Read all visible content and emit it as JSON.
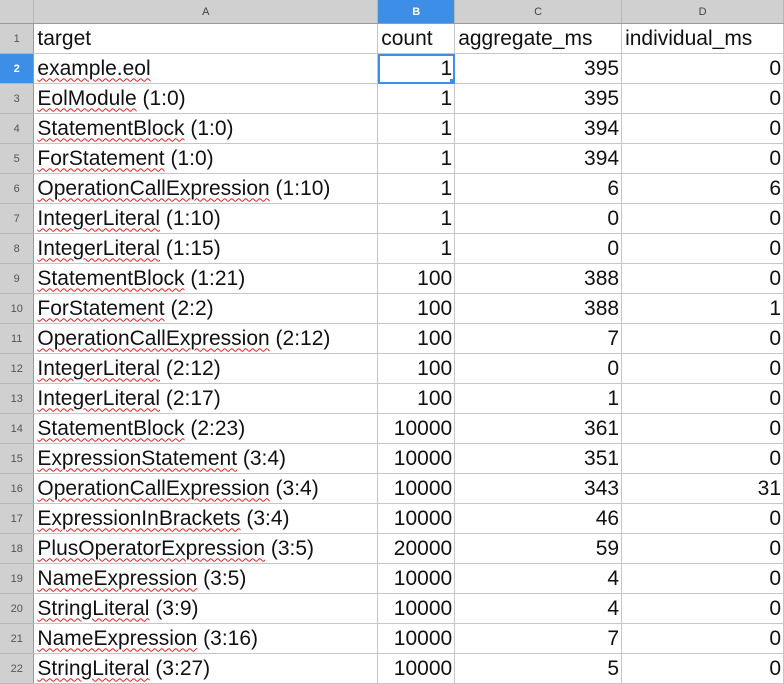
{
  "columns": [
    "A",
    "B",
    "C",
    "D"
  ],
  "selected_column": "B",
  "selected_row": 2,
  "active_cell": "B2",
  "header_row": {
    "row": 1,
    "values": [
      "target",
      "count",
      "aggregate_ms",
      "individual_ms"
    ]
  },
  "rows": [
    {
      "row": 2,
      "target_name": "example.eol",
      "target_loc": "",
      "count": "1",
      "aggregate_ms": "395",
      "individual_ms": "0"
    },
    {
      "row": 3,
      "target_name": "EolModule",
      "target_loc": " (1:0)",
      "count": "1",
      "aggregate_ms": "395",
      "individual_ms": "0"
    },
    {
      "row": 4,
      "target_name": "StatementBlock",
      "target_loc": " (1:0)",
      "count": "1",
      "aggregate_ms": "394",
      "individual_ms": "0"
    },
    {
      "row": 5,
      "target_name": "ForStatement",
      "target_loc": " (1:0)",
      "count": "1",
      "aggregate_ms": "394",
      "individual_ms": "0"
    },
    {
      "row": 6,
      "target_name": "OperationCallExpression",
      "target_loc": " (1:10)",
      "count": "1",
      "aggregate_ms": "6",
      "individual_ms": "6"
    },
    {
      "row": 7,
      "target_name": "IntegerLiteral",
      "target_loc": " (1:10)",
      "count": "1",
      "aggregate_ms": "0",
      "individual_ms": "0"
    },
    {
      "row": 8,
      "target_name": "IntegerLiteral",
      "target_loc": " (1:15)",
      "count": "1",
      "aggregate_ms": "0",
      "individual_ms": "0"
    },
    {
      "row": 9,
      "target_name": "StatementBlock",
      "target_loc": " (1:21)",
      "count": "100",
      "aggregate_ms": "388",
      "individual_ms": "0"
    },
    {
      "row": 10,
      "target_name": "ForStatement",
      "target_loc": " (2:2)",
      "count": "100",
      "aggregate_ms": "388",
      "individual_ms": "1"
    },
    {
      "row": 11,
      "target_name": "OperationCallExpression",
      "target_loc": " (2:12)",
      "count": "100",
      "aggregate_ms": "7",
      "individual_ms": "0"
    },
    {
      "row": 12,
      "target_name": "IntegerLiteral",
      "target_loc": " (2:12)",
      "count": "100",
      "aggregate_ms": "0",
      "individual_ms": "0"
    },
    {
      "row": 13,
      "target_name": "IntegerLiteral",
      "target_loc": " (2:17)",
      "count": "100",
      "aggregate_ms": "1",
      "individual_ms": "0"
    },
    {
      "row": 14,
      "target_name": "StatementBlock",
      "target_loc": " (2:23)",
      "count": "10000",
      "aggregate_ms": "361",
      "individual_ms": "0"
    },
    {
      "row": 15,
      "target_name": "ExpressionStatement",
      "target_loc": " (3:4)",
      "count": "10000",
      "aggregate_ms": "351",
      "individual_ms": "0"
    },
    {
      "row": 16,
      "target_name": "OperationCallExpression",
      "target_loc": " (3:4)",
      "count": "10000",
      "aggregate_ms": "343",
      "individual_ms": "31"
    },
    {
      "row": 17,
      "target_name": "ExpressionInBrackets",
      "target_loc": " (3:4)",
      "count": "10000",
      "aggregate_ms": "46",
      "individual_ms": "0"
    },
    {
      "row": 18,
      "target_name": "PlusOperatorExpression",
      "target_loc": " (3:5)",
      "count": "20000",
      "aggregate_ms": "59",
      "individual_ms": "0"
    },
    {
      "row": 19,
      "target_name": "NameExpression",
      "target_loc": " (3:5)",
      "count": "10000",
      "aggregate_ms": "4",
      "individual_ms": "0"
    },
    {
      "row": 20,
      "target_name": "StringLiteral",
      "target_loc": " (3:9)",
      "count": "10000",
      "aggregate_ms": "4",
      "individual_ms": "0"
    },
    {
      "row": 21,
      "target_name": "NameExpression",
      "target_loc": " (3:16)",
      "count": "10000",
      "aggregate_ms": "7",
      "individual_ms": "0"
    },
    {
      "row": 22,
      "target_name": "StringLiteral",
      "target_loc": " (3:27)",
      "count": "10000",
      "aggregate_ms": "5",
      "individual_ms": "0"
    }
  ],
  "colors": {
    "selection": "#3c8ee6",
    "header_bg": "#d0d0d0",
    "spellcheck": "#e02020"
  }
}
